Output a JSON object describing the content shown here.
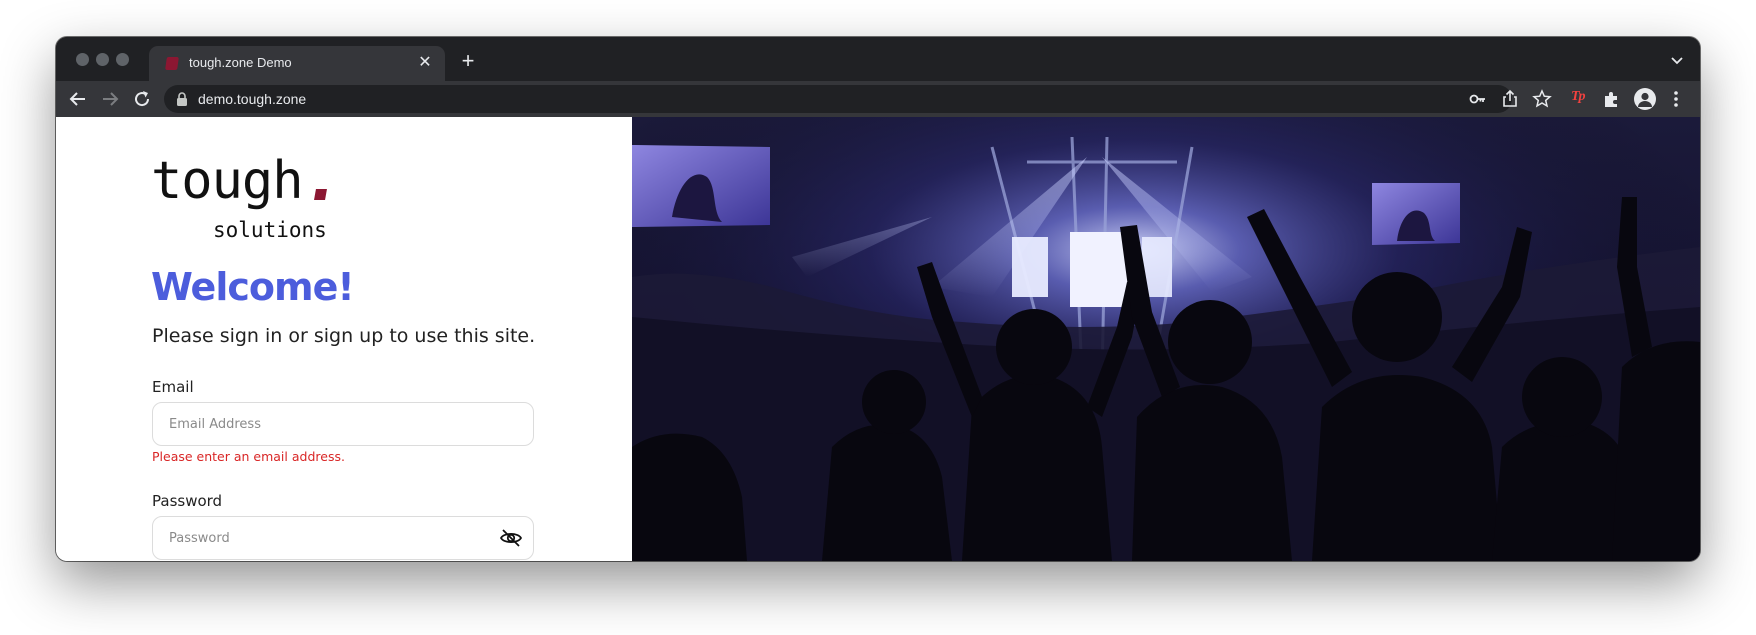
{
  "browser": {
    "tab": {
      "title": "tough.zone Demo",
      "favicon": "tough-zone-favicon"
    },
    "address_bar": {
      "url": "demo.tough.zone"
    },
    "extension_label": "Tp",
    "icons": [
      "back-icon",
      "forward-icon",
      "reload-icon",
      "lock-icon",
      "key-icon",
      "share-icon",
      "star-icon",
      "extensions-icon",
      "profile-icon",
      "more-icon",
      "tab-search-icon",
      "close-icon",
      "plus-icon"
    ]
  },
  "page": {
    "logo": {
      "word": "tough",
      "sub": "solutions",
      "accent_color": "#8c1732"
    },
    "welcome": "Welcome!",
    "subtitle": "Please sign in or sign up to use this site.",
    "email": {
      "label": "Email",
      "placeholder": "Email Address",
      "value": "",
      "error": "Please enter an email address."
    },
    "password": {
      "label": "Password",
      "placeholder": "Password",
      "value": ""
    }
  },
  "colors": {
    "welcome": "#4c5ddc",
    "error": "#d92626",
    "chrome_dark": "#202124",
    "chrome_toolbar": "#35363a"
  }
}
